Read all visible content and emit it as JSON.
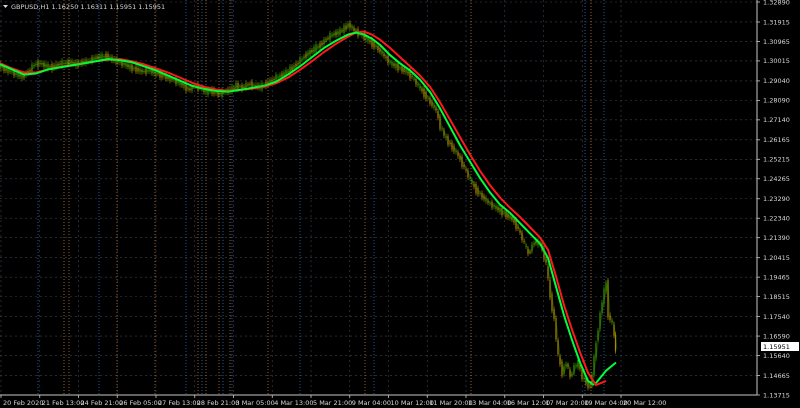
{
  "header": {
    "symbol_ohlc": "GBPUSD,H1  1.16250 1.16311 1.15951 1.15951"
  },
  "current_price": "1.15951",
  "colors": {
    "background": "#000000",
    "axis": "#c8c8c8",
    "grid": "#3a4454",
    "bull_candle": "#3a9a00",
    "bear_candle": "#b08a00",
    "ma_fast": "#00ff3a",
    "ma_slow": "#ff1a1a",
    "vline_blue": "#2a6fbf",
    "vline_orange": "#c07a30",
    "price_tag_bg": "#ffffff"
  },
  "chart_data": {
    "type": "line",
    "symbol": "GBPUSD",
    "timeframe": "H1",
    "y_ticks": [
      "1.32890",
      "1.31915",
      "1.30965",
      "1.30015",
      "1.29040",
      "1.28090",
      "1.27140",
      "1.26165",
      "1.25215",
      "1.24265",
      "1.23290",
      "1.22340",
      "1.21390",
      "1.20415",
      "1.19465",
      "1.18515",
      "1.17540",
      "1.16590",
      "1.15640",
      "1.14665",
      "1.13715"
    ],
    "ylim": [
      1.13715,
      1.3289
    ],
    "x_ticks": [
      "20 Feb 2020",
      "21 Feb 13:00",
      "24 Feb 21:00",
      "26 Feb 05:00",
      "27 Feb 13:00",
      "28 Feb 21:00",
      "3 Mar 05:00",
      "4 Mar 13:00",
      "5 Mar 21:00",
      "9 Mar 04:00",
      "10 Mar 12:00",
      "11 Mar 20:00",
      "13 Mar 04:00",
      "16 Mar 12:00",
      "17 Mar 20:00",
      "19 Mar 04:00",
      "20 Mar 12:00"
    ],
    "price_series": [
      [
        0,
        1.298
      ],
      [
        6,
        1.296
      ],
      [
        12,
        1.295
      ],
      [
        18,
        1.2935
      ],
      [
        24,
        1.2925
      ],
      [
        30,
        1.295
      ],
      [
        36,
        1.2985
      ],
      [
        42,
        1.299
      ],
      [
        48,
        1.2975
      ],
      [
        54,
        1.297
      ],
      [
        60,
        1.2985
      ],
      [
        66,
        1.299
      ],
      [
        72,
        1.2995
      ],
      [
        78,
        1.2985
      ],
      [
        84,
        1.2995
      ],
      [
        90,
        1.3
      ],
      [
        96,
        1.3015
      ],
      [
        102,
        1.302
      ],
      [
        108,
        1.3025
      ],
      [
        114,
        1.301
      ],
      [
        120,
        1.2995
      ],
      [
        126,
        1.2985
      ],
      [
        132,
        1.297
      ],
      [
        138,
        1.296
      ],
      [
        144,
        1.295
      ],
      [
        150,
        1.2955
      ],
      [
        156,
        1.2945
      ],
      [
        162,
        1.2935
      ],
      [
        168,
        1.292
      ],
      [
        174,
        1.291
      ],
      [
        180,
        1.2895
      ],
      [
        186,
        1.288
      ],
      [
        190,
        1.286
      ],
      [
        196,
        1.288
      ],
      [
        202,
        1.287
      ],
      [
        208,
        1.285
      ],
      [
        214,
        1.2855
      ],
      [
        220,
        1.284
      ],
      [
        226,
        1.285
      ],
      [
        232,
        1.286
      ],
      [
        238,
        1.288
      ],
      [
        244,
        1.287
      ],
      [
        250,
        1.289
      ],
      [
        256,
        1.288
      ],
      [
        262,
        1.2875
      ],
      [
        268,
        1.289
      ],
      [
        274,
        1.291
      ],
      [
        280,
        1.2925
      ],
      [
        286,
        1.294
      ],
      [
        292,
        1.296
      ],
      [
        298,
        1.2985
      ],
      [
        304,
        1.3015
      ],
      [
        310,
        1.304
      ],
      [
        316,
        1.306
      ],
      [
        322,
        1.308
      ],
      [
        328,
        1.311
      ],
      [
        334,
        1.313
      ],
      [
        340,
        1.314
      ],
      [
        346,
        1.316
      ],
      [
        350,
        1.318
      ],
      [
        356,
        1.315
      ],
      [
        362,
        1.313
      ],
      [
        368,
        1.311
      ],
      [
        374,
        1.3085
      ],
      [
        380,
        1.306
      ],
      [
        386,
        1.3025
      ],
      [
        392,
        1.299
      ],
      [
        398,
        1.2975
      ],
      [
        404,
        1.296
      ],
      [
        408,
        1.295
      ],
      [
        414,
        1.292
      ],
      [
        420,
        1.288
      ],
      [
        426,
        1.284
      ],
      [
        432,
        1.28
      ],
      [
        438,
        1.276
      ],
      [
        442,
        1.268
      ],
      [
        448,
        1.262
      ],
      [
        454,
        1.258
      ],
      [
        460,
        1.254
      ],
      [
        466,
        1.248
      ],
      [
        472,
        1.242
      ],
      [
        478,
        1.237
      ],
      [
        484,
        1.234
      ],
      [
        490,
        1.231
      ],
      [
        496,
        1.229
      ],
      [
        502,
        1.227
      ],
      [
        508,
        1.225
      ],
      [
        514,
        1.223
      ],
      [
        520,
        1.218
      ],
      [
        526,
        1.211
      ],
      [
        530,
        1.206
      ],
      [
        536,
        1.212
      ],
      [
        542,
        1.211
      ],
      [
        548,
        1.201
      ],
      [
        552,
        1.185
      ],
      [
        556,
        1.174
      ],
      [
        560,
        1.156
      ],
      [
        564,
        1.148
      ],
      [
        568,
        1.153
      ],
      [
        572,
        1.146
      ],
      [
        576,
        1.151
      ],
      [
        580,
        1.153
      ],
      [
        584,
        1.146
      ],
      [
        588,
        1.143
      ],
      [
        592,
        1.141
      ],
      [
        596,
        1.155
      ],
      [
        600,
        1.17
      ],
      [
        604,
        1.183
      ],
      [
        608,
        1.192
      ],
      [
        610,
        1.176
      ],
      [
        614,
        1.172
      ],
      [
        617,
        1.1595
      ]
    ],
    "ma_fast_series": [
      [
        0,
        1.2985
      ],
      [
        12,
        1.296
      ],
      [
        24,
        1.2935
      ],
      [
        36,
        1.294
      ],
      [
        48,
        1.296
      ],
      [
        60,
        1.297
      ],
      [
        72,
        1.298
      ],
      [
        84,
        1.299
      ],
      [
        96,
        1.3
      ],
      [
        108,
        1.301
      ],
      [
        120,
        1.3005
      ],
      [
        132,
        1.2995
      ],
      [
        144,
        1.2975
      ],
      [
        156,
        1.2955
      ],
      [
        168,
        1.293
      ],
      [
        180,
        1.2905
      ],
      [
        192,
        1.288
      ],
      [
        204,
        1.2865
      ],
      [
        216,
        1.2855
      ],
      [
        228,
        1.2852
      ],
      [
        240,
        1.286
      ],
      [
        252,
        1.287
      ],
      [
        264,
        1.288
      ],
      [
        276,
        1.29
      ],
      [
        288,
        1.2935
      ],
      [
        300,
        1.2975
      ],
      [
        312,
        1.302
      ],
      [
        324,
        1.3065
      ],
      [
        336,
        1.31
      ],
      [
        348,
        1.313
      ],
      [
        356,
        1.314
      ],
      [
        364,
        1.313
      ],
      [
        372,
        1.311
      ],
      [
        380,
        1.308
      ],
      [
        390,
        1.303
      ],
      [
        400,
        1.299
      ],
      [
        410,
        1.2955
      ],
      [
        420,
        1.291
      ],
      [
        430,
        1.285
      ],
      [
        440,
        1.277
      ],
      [
        450,
        1.268
      ],
      [
        460,
        1.259
      ],
      [
        470,
        1.251
      ],
      [
        480,
        1.243
      ],
      [
        490,
        1.236
      ],
      [
        500,
        1.23
      ],
      [
        510,
        1.226
      ],
      [
        520,
        1.221
      ],
      [
        530,
        1.216
      ],
      [
        540,
        1.211
      ],
      [
        548,
        1.204
      ],
      [
        556,
        1.19
      ],
      [
        564,
        1.176
      ],
      [
        572,
        1.164
      ],
      [
        580,
        1.153
      ],
      [
        588,
        1.144
      ],
      [
        594,
        1.142
      ]
    ],
    "ma_fast_tail": [
      [
        596,
        1.143
      ],
      [
        606,
        1.149
      ],
      [
        616,
        1.153
      ]
    ],
    "ma_slow_series": [
      [
        0,
        1.299
      ],
      [
        12,
        1.2965
      ],
      [
        24,
        1.2945
      ],
      [
        36,
        1.2945
      ],
      [
        48,
        1.296
      ],
      [
        60,
        1.2972
      ],
      [
        72,
        1.2982
      ],
      [
        84,
        1.299
      ],
      [
        96,
        1.3
      ],
      [
        108,
        1.3008
      ],
      [
        120,
        1.301
      ],
      [
        132,
        1.3
      ],
      [
        144,
        1.2985
      ],
      [
        156,
        1.2965
      ],
      [
        168,
        1.2945
      ],
      [
        180,
        1.292
      ],
      [
        192,
        1.2895
      ],
      [
        204,
        1.2875
      ],
      [
        216,
        1.2862
      ],
      [
        228,
        1.2856
      ],
      [
        240,
        1.286
      ],
      [
        252,
        1.2866
      ],
      [
        264,
        1.2876
      ],
      [
        276,
        1.2892
      ],
      [
        288,
        1.292
      ],
      [
        300,
        1.2958
      ],
      [
        312,
        1.3
      ],
      [
        324,
        1.3045
      ],
      [
        336,
        1.3085
      ],
      [
        348,
        1.312
      ],
      [
        356,
        1.314
      ],
      [
        364,
        1.3145
      ],
      [
        372,
        1.313
      ],
      [
        380,
        1.3105
      ],
      [
        390,
        1.3065
      ],
      [
        400,
        1.302
      ],
      [
        410,
        1.2975
      ],
      [
        420,
        1.293
      ],
      [
        430,
        1.2875
      ],
      [
        440,
        1.28
      ],
      [
        450,
        1.2715
      ],
      [
        460,
        1.263
      ],
      [
        470,
        1.2545
      ],
      [
        480,
        1.2465
      ],
      [
        490,
        1.2395
      ],
      [
        500,
        1.2335
      ],
      [
        510,
        1.2285
      ],
      [
        520,
        1.224
      ],
      [
        530,
        1.219
      ],
      [
        540,
        1.214
      ],
      [
        548,
        1.208
      ],
      [
        556,
        1.195
      ],
      [
        564,
        1.181
      ],
      [
        572,
        1.169
      ],
      [
        580,
        1.158
      ],
      [
        588,
        1.148
      ],
      [
        596,
        1.142
      ],
      [
        606,
        1.144
      ]
    ],
    "vlines": [
      {
        "x": 38,
        "c": "blue"
      },
      {
        "x": 64,
        "c": "orange"
      },
      {
        "x": 69,
        "c": "orange"
      },
      {
        "x": 99,
        "c": "blue"
      },
      {
        "x": 117,
        "c": "orange"
      },
      {
        "x": 155,
        "c": "orange"
      },
      {
        "x": 186,
        "c": "blue"
      },
      {
        "x": 198,
        "c": "orange"
      },
      {
        "x": 202,
        "c": "blue"
      },
      {
        "x": 206,
        "c": "orange"
      },
      {
        "x": 219,
        "c": "orange"
      },
      {
        "x": 223,
        "c": "blue"
      },
      {
        "x": 230,
        "c": "orange"
      },
      {
        "x": 232,
        "c": "blue"
      },
      {
        "x": 268,
        "c": "orange"
      },
      {
        "x": 300,
        "c": "blue"
      },
      {
        "x": 365,
        "c": "orange"
      },
      {
        "x": 374,
        "c": "blue"
      },
      {
        "x": 471,
        "c": "orange"
      },
      {
        "x": 585,
        "c": "blue"
      },
      {
        "x": 591,
        "c": "orange"
      },
      {
        "x": 604,
        "c": "blue"
      }
    ]
  }
}
